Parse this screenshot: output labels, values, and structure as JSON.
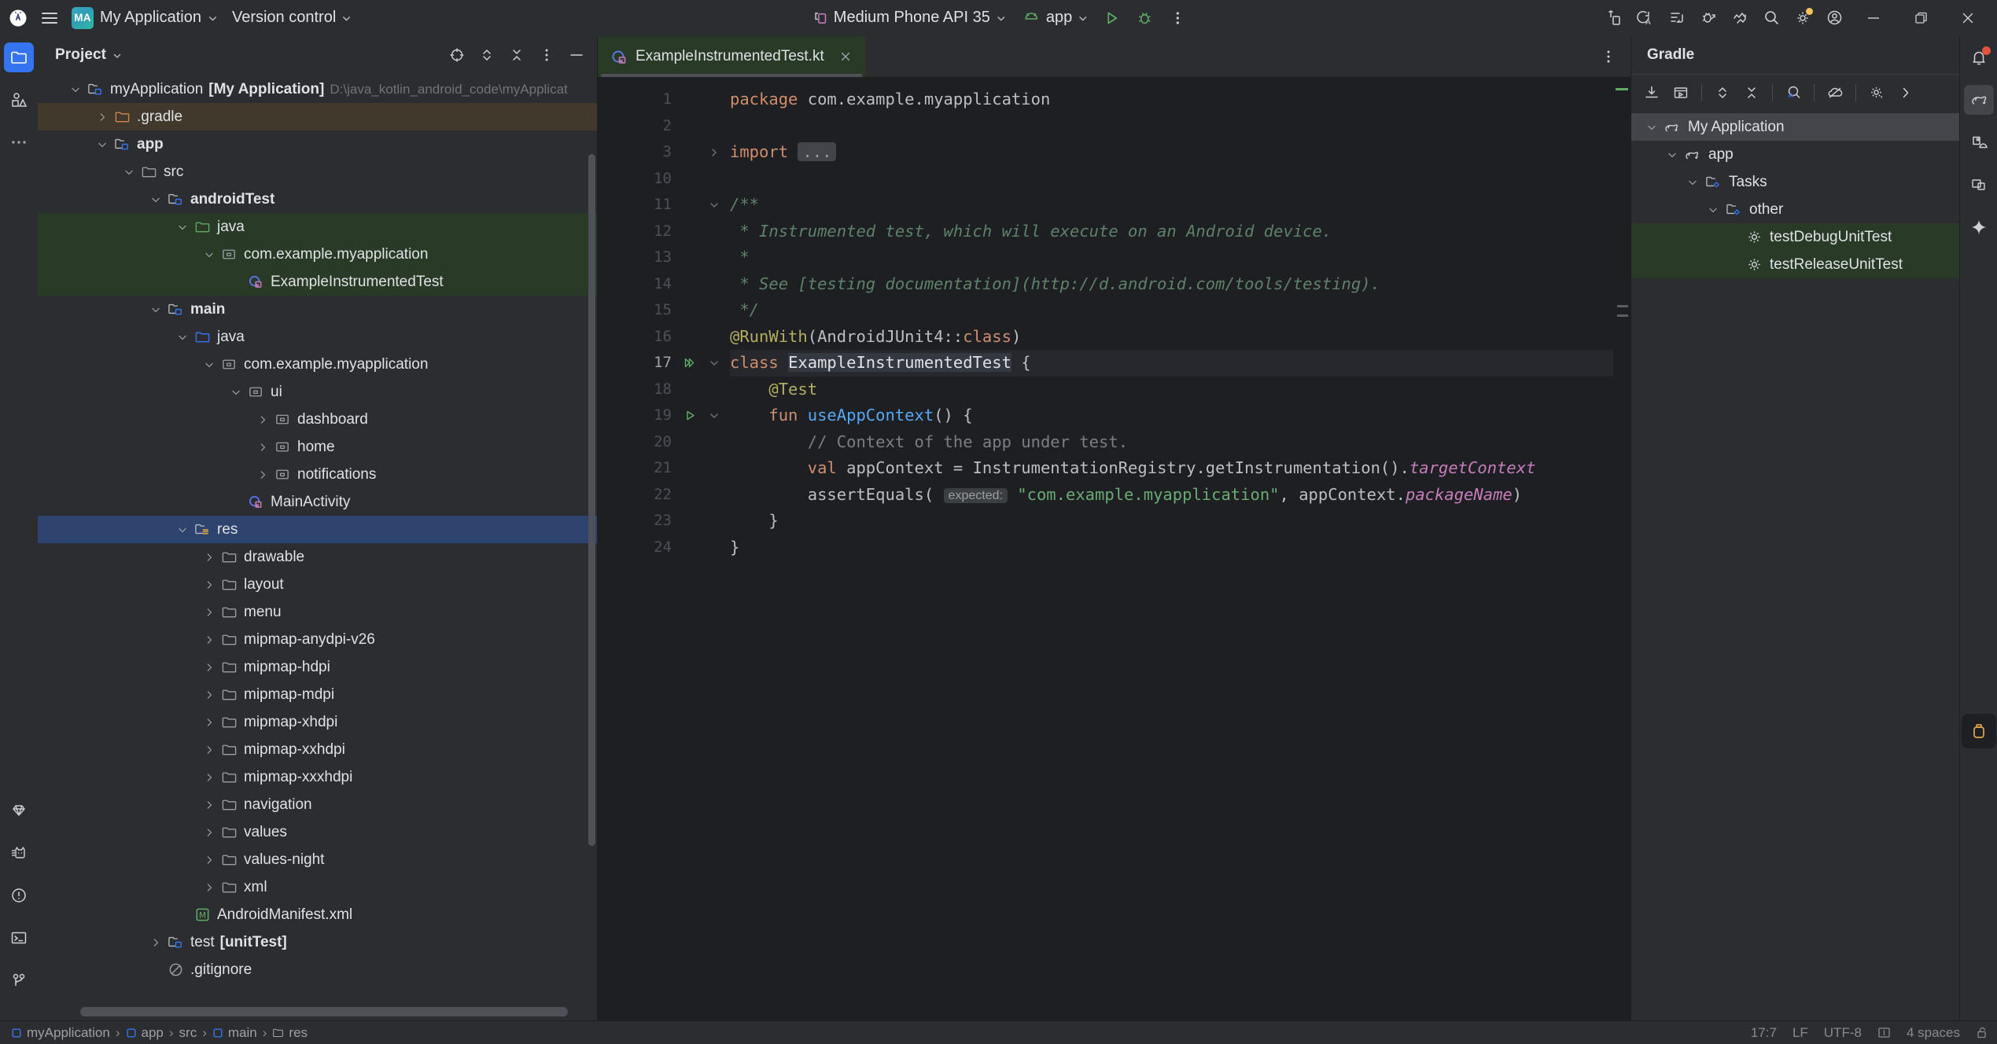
{
  "window": {
    "app_icon": "android-studio-icon",
    "menu_icon": "hamburger-menu-icon",
    "project_badge": "MA",
    "project_name": "My Application",
    "version_control": "Version control",
    "device": "Medium Phone API 35",
    "run_config": "app",
    "minimize": "–",
    "restore": "restore",
    "close": "✕"
  },
  "toolbar_right_icons": [
    "device-manager-icon",
    "translations-icon",
    "build-icon",
    "debug-attach-icon",
    "profiler-icon",
    "search-icon",
    "settings-icon",
    "account-icon"
  ],
  "left_stripe": [
    {
      "name": "project-tool-icon",
      "active": true
    },
    {
      "name": "resource-manager-icon",
      "active": false
    },
    {
      "name": "more-tool-windows-icon",
      "active": false
    }
  ],
  "left_stripe_bottom": [
    {
      "name": "gemini-icon"
    },
    {
      "name": "logcat-icon"
    },
    {
      "name": "problems-icon"
    },
    {
      "name": "terminal-icon"
    },
    {
      "name": "version-control-icon"
    }
  ],
  "right_stripe": [
    {
      "name": "notifications-bell-icon",
      "badge": true
    },
    {
      "name": "gradle-elephant-icon",
      "active": true
    },
    {
      "name": "device-file-explorer-icon",
      "active": false
    },
    {
      "name": "running-devices-icon",
      "active": false
    },
    {
      "name": "gemini-sparkle-icon",
      "active": false
    }
  ],
  "project_panel": {
    "title": "Project",
    "header_icons": [
      "locate-icon",
      "expand-collapse-icon",
      "collapse-all-icon",
      "options-icon",
      "hide-icon"
    ],
    "tree": [
      {
        "id": "myapplication",
        "label": "myApplication",
        "bold_label": "[My Application]",
        "sub": "D:\\java_kotlin_android_code\\myApplicat",
        "indent": 0,
        "twisty": "down",
        "icon": "module-folder-icon",
        "state": "normal"
      },
      {
        "id": "gradle",
        "label": ".gradle",
        "indent": 1,
        "twisty": "right",
        "icon": "folder-orange-icon",
        "state": "brown"
      },
      {
        "id": "app",
        "label": "app",
        "indent": 1,
        "twisty": "down",
        "icon": "module-folder-icon",
        "bold": true,
        "state": "normal"
      },
      {
        "id": "src",
        "label": "src",
        "indent": 2,
        "twisty": "down",
        "icon": "folder-icon",
        "state": "normal"
      },
      {
        "id": "androidTest",
        "label": "androidTest",
        "indent": 3,
        "twisty": "down",
        "icon": "module-folder-icon",
        "bold": true,
        "state": "normal"
      },
      {
        "id": "androidTest-java",
        "label": "java",
        "indent": 4,
        "twisty": "down",
        "icon": "folder-green-icon",
        "state": "green"
      },
      {
        "id": "androidTest-pkg",
        "label": "com.example.myapplication",
        "indent": 5,
        "twisty": "down",
        "icon": "package-icon",
        "state": "green"
      },
      {
        "id": "ExampleInstrumentedTest",
        "label": "ExampleInstrumentedTest",
        "indent": 6,
        "twisty": "none",
        "icon": "kotlin-class-icon",
        "state": "green"
      },
      {
        "id": "main",
        "label": "main",
        "indent": 3,
        "twisty": "down",
        "icon": "module-folder-icon",
        "bold": true,
        "state": "normal"
      },
      {
        "id": "main-java",
        "label": "java",
        "indent": 4,
        "twisty": "down",
        "icon": "folder-blue-icon",
        "state": "normal"
      },
      {
        "id": "main-pkg",
        "label": "com.example.myapplication",
        "indent": 5,
        "twisty": "down",
        "icon": "package-icon",
        "state": "normal"
      },
      {
        "id": "ui",
        "label": "ui",
        "indent": 6,
        "twisty": "down",
        "icon": "package-icon",
        "state": "normal"
      },
      {
        "id": "dashboard",
        "label": "dashboard",
        "indent": 7,
        "twisty": "right",
        "icon": "package-icon",
        "state": "normal"
      },
      {
        "id": "home",
        "label": "home",
        "indent": 7,
        "twisty": "right",
        "icon": "package-icon",
        "state": "normal"
      },
      {
        "id": "notifications",
        "label": "notifications",
        "indent": 7,
        "twisty": "right",
        "icon": "package-icon",
        "state": "normal"
      },
      {
        "id": "MainActivity",
        "label": "MainActivity",
        "indent": 6,
        "twisty": "none",
        "icon": "kotlin-class-icon",
        "state": "normal"
      },
      {
        "id": "res",
        "label": "res",
        "indent": 4,
        "twisty": "down",
        "icon": "res-folder-icon",
        "state": "selected"
      },
      {
        "id": "drawable",
        "label": "drawable",
        "indent": 5,
        "twisty": "right",
        "icon": "folder-icon",
        "state": "normal"
      },
      {
        "id": "layout",
        "label": "layout",
        "indent": 5,
        "twisty": "right",
        "icon": "folder-icon",
        "state": "normal"
      },
      {
        "id": "menu",
        "label": "menu",
        "indent": 5,
        "twisty": "right",
        "icon": "folder-icon",
        "state": "normal"
      },
      {
        "id": "mipmap-anydpi-v26",
        "label": "mipmap-anydpi-v26",
        "indent": 5,
        "twisty": "right",
        "icon": "folder-icon",
        "state": "normal"
      },
      {
        "id": "mipmap-hdpi",
        "label": "mipmap-hdpi",
        "indent": 5,
        "twisty": "right",
        "icon": "folder-icon",
        "state": "normal"
      },
      {
        "id": "mipmap-mdpi",
        "label": "mipmap-mdpi",
        "indent": 5,
        "twisty": "right",
        "icon": "folder-icon",
        "state": "normal"
      },
      {
        "id": "mipmap-xhdpi",
        "label": "mipmap-xhdpi",
        "indent": 5,
        "twisty": "right",
        "icon": "folder-icon",
        "state": "normal"
      },
      {
        "id": "mipmap-xxhdpi",
        "label": "mipmap-xxhdpi",
        "indent": 5,
        "twisty": "right",
        "icon": "folder-icon",
        "state": "normal"
      },
      {
        "id": "mipmap-xxxhdpi",
        "label": "mipmap-xxxhdpi",
        "indent": 5,
        "twisty": "right",
        "icon": "folder-icon",
        "state": "normal"
      },
      {
        "id": "navigation",
        "label": "navigation",
        "indent": 5,
        "twisty": "right",
        "icon": "folder-icon",
        "state": "normal"
      },
      {
        "id": "values",
        "label": "values",
        "indent": 5,
        "twisty": "right",
        "icon": "folder-icon",
        "state": "normal"
      },
      {
        "id": "values-night",
        "label": "values-night",
        "indent": 5,
        "twisty": "right",
        "icon": "folder-icon",
        "state": "normal"
      },
      {
        "id": "xml",
        "label": "xml",
        "indent": 5,
        "twisty": "right",
        "icon": "folder-icon",
        "state": "normal"
      },
      {
        "id": "AndroidManifest.xml",
        "label": "AndroidManifest.xml",
        "indent": 4,
        "twisty": "none",
        "icon": "manifest-icon",
        "state": "normal"
      },
      {
        "id": "test",
        "label": "test",
        "bold_label": "[unitTest]",
        "indent": 3,
        "twisty": "right",
        "icon": "module-folder-icon",
        "state": "normal"
      },
      {
        "id": "gitignore",
        "label": ".gitignore",
        "indent": 3,
        "twisty": "none",
        "icon": "gitignore-icon",
        "state": "normal"
      }
    ]
  },
  "editor": {
    "tab": {
      "label": "ExampleInstrumentedTest.kt",
      "icon": "kotlin-class-icon",
      "close": "✕"
    },
    "more_icon": "editor-options-icon",
    "check_icon": "inspections-ok-icon",
    "lines": [
      {
        "n": "1",
        "run": "",
        "fold": "",
        "html": "<span class=\"k\">package</span> <span class=\"pl\">com.example.myapplication</span>"
      },
      {
        "n": "2",
        "run": "",
        "fold": "",
        "html": ""
      },
      {
        "n": "3",
        "run": "",
        "fold": "right",
        "html": "<span class=\"k\">import</span> <span class=\"chip-fold\">...</span>"
      },
      {
        "n": "10",
        "run": "",
        "fold": "",
        "html": ""
      },
      {
        "n": "11",
        "run": "",
        "fold": "down",
        "html": "<span class=\"cm\">/**</span>"
      },
      {
        "n": "12",
        "run": "",
        "fold": "",
        "html": "<span class=\"cm\"> * Instrumented test, which will execute on an Android device.</span>"
      },
      {
        "n": "13",
        "run": "",
        "fold": "",
        "html": "<span class=\"cm\"> *</span>"
      },
      {
        "n": "14",
        "run": "",
        "fold": "",
        "html": "<span class=\"cm\"> * See [testing documentation](http://d.android.com/tools/testing).</span>"
      },
      {
        "n": "15",
        "run": "",
        "fold": "",
        "html": "<span class=\"cm\"> */</span>"
      },
      {
        "n": "16",
        "run": "",
        "fold": "",
        "html": "<span class=\"an\">@RunWith</span><span class=\"pl\">(AndroidJUnit4::</span><span class=\"k\">class</span><span class=\"pl\">)</span>"
      },
      {
        "n": "17",
        "run": "run-all",
        "fold": "down",
        "cur": true,
        "html": "<span class=\"k\">class</span> <span class=\"ident-hl\">ExampleInstrumentedTest</span> <span class=\"pl\">{</span>"
      },
      {
        "n": "18",
        "run": "",
        "fold": "",
        "html": "    <span class=\"an\">@Test</span>"
      },
      {
        "n": "19",
        "run": "run",
        "fold": "down",
        "html": "    <span class=\"k\">fun</span> <span class=\"fn\">useAppContext</span><span class=\"pl\">() {</span>"
      },
      {
        "n": "20",
        "run": "",
        "fold": "",
        "html": "        <span class=\"lc\">// Context of the app under test.</span>"
      },
      {
        "n": "21",
        "run": "",
        "fold": "",
        "html": "        <span class=\"k\">val</span> <span class=\"pl\">appContext = InstrumentationRegistry.getInstrumentation().</span><span class=\"pr\">targetContext</span>"
      },
      {
        "n": "22",
        "run": "",
        "fold": "",
        "html": "        <span class=\"pl\">assertEquals(</span> <span class=\"chip-hint\">expected:</span> <span class=\"st\">\"com.example.myapplication\"</span><span class=\"pl\">, appContext.</span><span class=\"pr\">packageName</span><span class=\"pl\">)</span>"
      },
      {
        "n": "23",
        "run": "",
        "fold": "",
        "html": "    <span class=\"pl\">}</span>"
      },
      {
        "n": "24",
        "run": "",
        "fold": "",
        "html": "<span class=\"pl\">}</span>"
      }
    ]
  },
  "gradle_panel": {
    "title": "Gradle",
    "tool_icons": [
      "sync-gradle-icon",
      "execute-task-icon",
      "expand-collapse-icon",
      "collapse-all-icon",
      "toggle-offline-icon",
      "offline-mode-icon",
      "settings-icon",
      "more-icon"
    ],
    "tree": [
      {
        "id": "gradle-myapp",
        "label": "My Application",
        "indent": 0,
        "twisty": "down",
        "icon": "gradle-elephant-icon",
        "state": "selected"
      },
      {
        "id": "gradle-app",
        "label": "app",
        "indent": 1,
        "twisty": "down",
        "icon": "gradle-elephant-icon",
        "state": "normal"
      },
      {
        "id": "gradle-tasks",
        "label": "Tasks",
        "indent": 2,
        "twisty": "down",
        "icon": "tasks-folder-icon",
        "state": "normal"
      },
      {
        "id": "gradle-other",
        "label": "other",
        "indent": 3,
        "twisty": "down",
        "icon": "tasks-folder-icon",
        "state": "normal"
      },
      {
        "id": "testDebugUnitTest",
        "label": "testDebugUnitTest",
        "indent": 4,
        "twisty": "none",
        "icon": "gradle-task-icon",
        "state": "green"
      },
      {
        "id": "testReleaseUnitTest",
        "label": "testReleaseUnitTest",
        "indent": 4,
        "twisty": "none",
        "icon": "gradle-task-icon",
        "state": "green"
      }
    ]
  },
  "status_bar": {
    "breadcrumbs": [
      {
        "label": "myApplication",
        "icon": "module-icon"
      },
      {
        "label": "app",
        "icon": "module-icon"
      },
      {
        "label": "src",
        "icon": ""
      },
      {
        "label": "main",
        "icon": "module-icon"
      },
      {
        "label": "res",
        "icon": "folder-icon"
      }
    ],
    "separator": "›",
    "caret": "17:7",
    "line_sep": "LF",
    "encoding": "UTF-8",
    "indent_icon": "indent-icon",
    "indent": "4 spaces",
    "lock_icon": "lock-icon"
  },
  "colors": {
    "accent_blue": "#3574f0",
    "selection_blue": "#2e436e",
    "test_green": "#293b27",
    "panel_bg": "#2b2d30",
    "editor_bg": "#1e1f22"
  }
}
